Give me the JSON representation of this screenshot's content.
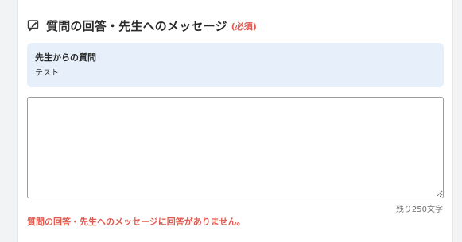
{
  "section": {
    "title": "質問の回答・先生へのメッセージ",
    "required_label": "(必須)",
    "icon": "message-edit-icon"
  },
  "question": {
    "label": "先生からの質問",
    "text": "テスト"
  },
  "answer": {
    "value": "",
    "placeholder": ""
  },
  "counter": {
    "text": "残り250文字"
  },
  "error": {
    "message": "質問の回答・先生へのメッセージに回答がありません。"
  },
  "colors": {
    "error": "#e05a50",
    "question_bg": "#e7f0fa",
    "page_bg": "#f2f3f5"
  }
}
